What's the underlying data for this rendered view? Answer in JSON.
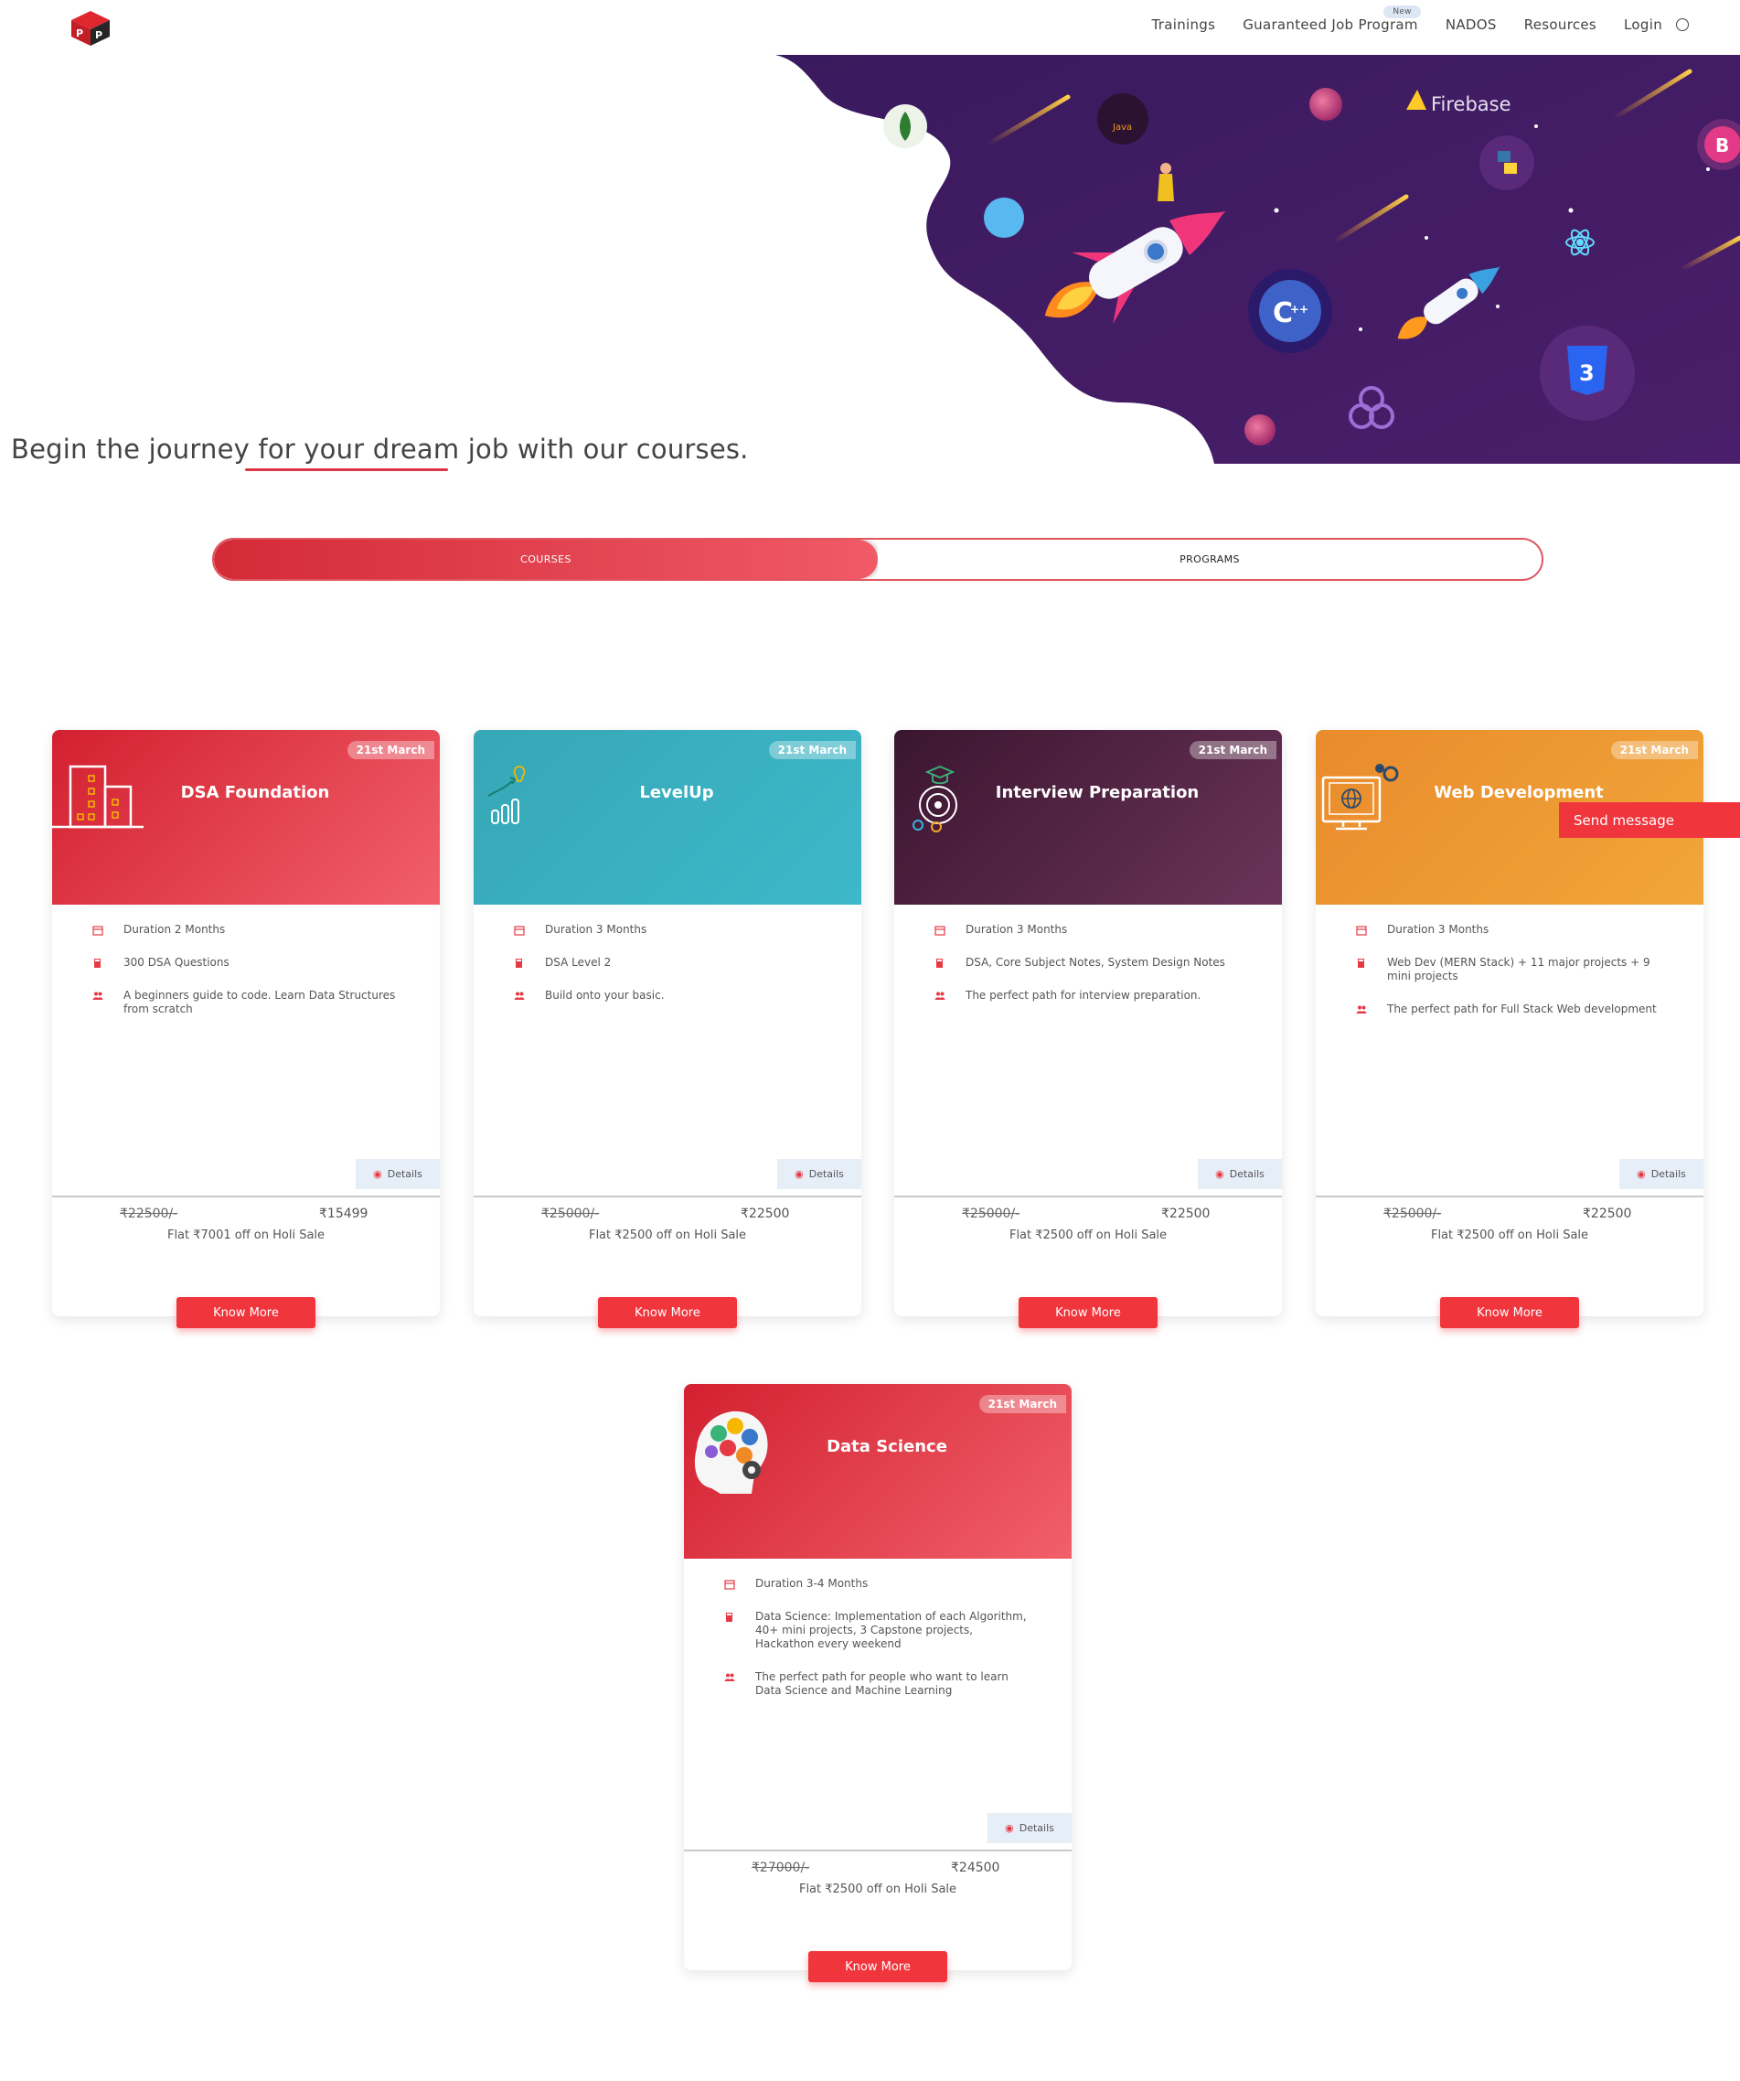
{
  "nav": {
    "items": [
      "Trainings",
      "Guaranteed Job Program",
      "NADOS",
      "Resources",
      "Login"
    ],
    "badge": "New"
  },
  "hero": {
    "firebase_label": "Firebase",
    "java_label": "Java",
    "b_label": "B",
    "headline": "Begin the journey for your dream job with our courses."
  },
  "toggle": {
    "courses": "COURSES",
    "programs": "PROGRAMS"
  },
  "colors": {
    "accent": "#f0353c",
    "red": "#d32030",
    "teal": "#36a7b6",
    "purple": "#3b1530",
    "orange": "#e98b2c"
  },
  "cards": [
    {
      "title": "DSA Foundation",
      "ribbon": "21st March",
      "items": [
        "Duration 2 Months",
        "300 DSA Questions",
        "A beginners guide to code. Learn Data Structures from scratch"
      ],
      "details": "Details",
      "old_price": "₹22500/-",
      "new_price": "₹15499",
      "note": "Flat ₹7001 off on Holi Sale",
      "cta": "Know More"
    },
    {
      "title": "LevelUp",
      "ribbon": "21st March",
      "items": [
        "Duration 3 Months",
        "DSA Level 2",
        "Build onto your basic."
      ],
      "details": "Details",
      "old_price": "₹25000/-",
      "new_price": "₹22500",
      "note": "Flat ₹2500 off on Holi Sale",
      "cta": "Know More"
    },
    {
      "title": "Interview Preparation",
      "ribbon": "21st March",
      "items": [
        "Duration 3 Months",
        "DSA, Core Subject Notes, System Design Notes",
        "The perfect path for interview preparation."
      ],
      "details": "Details",
      "old_price": "₹25000/-",
      "new_price": "₹22500",
      "note": "Flat ₹2500 off on Holi Sale",
      "cta": "Know More"
    },
    {
      "title": "Web Development",
      "ribbon": "21st March",
      "items": [
        "Duration 3 Months",
        "Web Dev (MERN Stack) + 11 major projects + 9 mini projects",
        "The perfect path for Full Stack Web development"
      ],
      "details": "Details",
      "old_price": "₹25000/-",
      "new_price": "₹22500",
      "note": "Flat ₹2500 off on Holi Sale",
      "cta": "Know More"
    },
    {
      "title": "Data Science",
      "ribbon": "21st March",
      "items": [
        "Duration 3-4 Months",
        "Data Science: Implementation of each Algorithm, 40+ mini projects, 3 Capstone projects, Hackathon every weekend",
        "The perfect path for people who want to learn Data Science and Machine Learning"
      ],
      "details": "Details",
      "old_price": "₹27000/-",
      "new_price": "₹24500",
      "note": "Flat ₹2500 off on Holi Sale",
      "cta": "Know More"
    }
  ],
  "chat": {
    "label": "Send message"
  }
}
